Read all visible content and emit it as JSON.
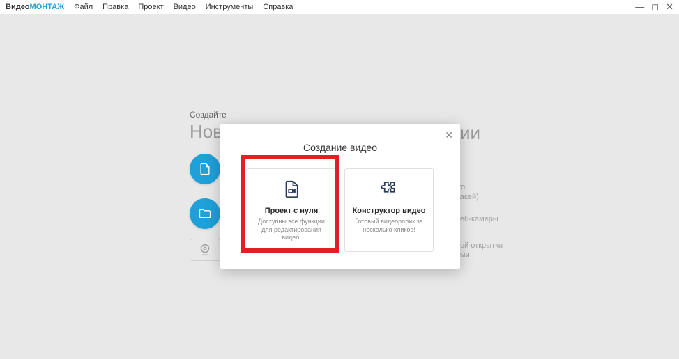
{
  "logo": {
    "part1": "Видео",
    "part2": "МОНТАЖ"
  },
  "menu": [
    "Файл",
    "Правка",
    "Проект",
    "Видео",
    "Инструменты",
    "Справка"
  ],
  "windowControls": {
    "min": "—",
    "max": "◻",
    "close": "✕"
  },
  "bgLeft": {
    "smallLabel": "Создайте",
    "heading": "Новы"
  },
  "bgRight": {
    "headingTail": "ии",
    "peek1": "тного",
    "peek2": "ромакей)",
    "peek3": "еб-камеры",
    "peek4a": "ой открытки",
    "peek4b": "ми"
  },
  "dialog": {
    "title": "Создание видео",
    "close": "✕",
    "cards": [
      {
        "title": "Проект с нуля",
        "desc": "Доступны все функции для редактирования видео."
      },
      {
        "title": "Конструктор видео",
        "desc": "Готовый видеоролик за несколько кликов!"
      }
    ]
  }
}
